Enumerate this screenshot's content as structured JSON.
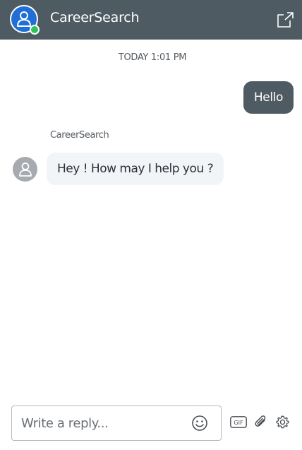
{
  "header": {
    "title": "CareerSearch",
    "avatar_icon": "user-icon",
    "status_color": "#2ec25a",
    "share_icon": "share-icon",
    "background": "#4f5b62"
  },
  "conversation": {
    "timestamp": "TODAY 1:01 PM",
    "messages": [
      {
        "direction": "outgoing",
        "text": "Hello"
      },
      {
        "direction": "incoming",
        "sender": "CareerSearch",
        "text": "Hey ! How may I help you ?"
      }
    ]
  },
  "composer": {
    "placeholder": "Write a reply...",
    "emoji_icon": "smiley-icon",
    "gif_label": "GIF",
    "attach_icon": "paperclip-icon",
    "settings_icon": "gear-icon"
  }
}
